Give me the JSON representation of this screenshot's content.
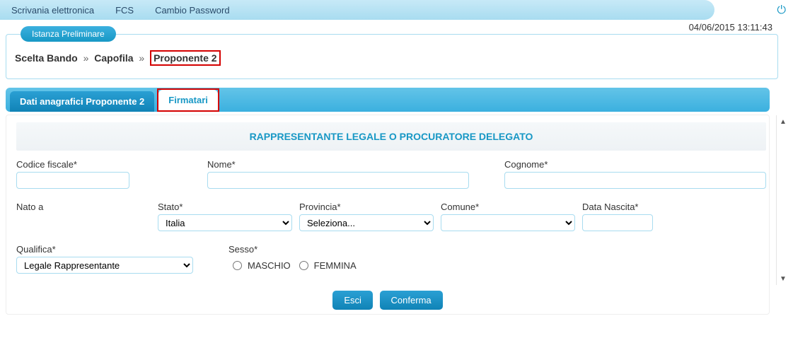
{
  "topnav": {
    "items": [
      "Scrivania elettronica",
      "FCS",
      "Cambio Password"
    ]
  },
  "timestamp": "04/06/2015 13:11:43",
  "panel": {
    "title": "Istanza Preliminare",
    "breadcrumb": {
      "c1": "Scelta Bando",
      "c2": "Capofila",
      "c3": "Proponente 2"
    }
  },
  "tabs": {
    "t1": "Dati anagrafici Proponente 2",
    "t2": "Firmatari"
  },
  "section_title": "RAPPRESENTANTE LEGALE O PROCURATORE DELEGATO",
  "labels": {
    "cf": "Codice fiscale*",
    "nome": "Nome*",
    "cognome": "Cognome*",
    "natoa": "Nato a",
    "stato": "Stato*",
    "provincia": "Provincia*",
    "comune": "Comune*",
    "data_nascita": "Data Nascita*",
    "qualifica": "Qualifica*",
    "sesso": "Sesso*",
    "maschio": "MASCHIO",
    "femmina": "FEMMINA"
  },
  "values": {
    "stato": "Italia",
    "provincia": "Seleziona...",
    "comune": "",
    "qualifica": "Legale Rappresentante"
  },
  "buttons": {
    "esci": "Esci",
    "conferma": "Conferma"
  }
}
